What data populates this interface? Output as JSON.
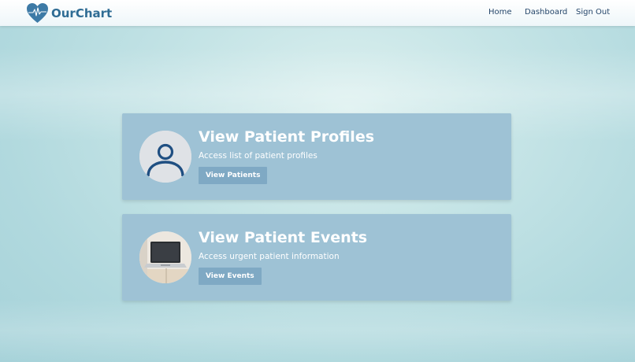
{
  "nav": {
    "brand": "OurChart",
    "links": [
      {
        "label": "Home"
      },
      {
        "label": "Dashboard"
      },
      {
        "label": "Sign Out"
      }
    ]
  },
  "cards": [
    {
      "title": "View Patient Profiles",
      "description": "Access list of patient profiles",
      "button": "View Patients",
      "icon": "user-profile-icon"
    },
    {
      "title": "View Patient Events",
      "description": "Access urgent patient information",
      "button": "View Events",
      "icon": "laptop-image"
    }
  ],
  "colors": {
    "brand": "#2f6c94",
    "card": "#9ec2d5",
    "button": "#7fa9c4",
    "heart": "#3d7aa6"
  }
}
